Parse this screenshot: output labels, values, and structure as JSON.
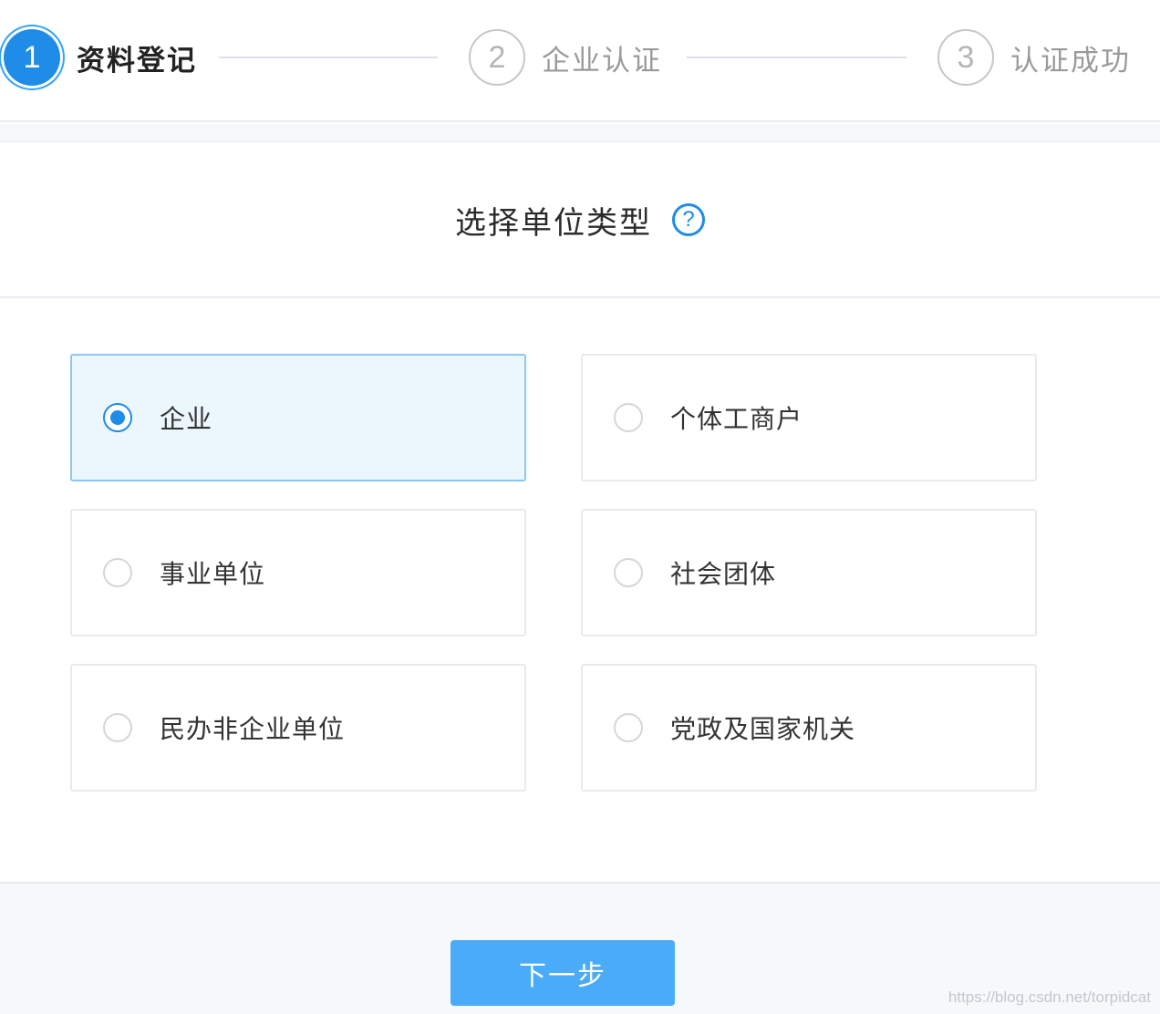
{
  "steps": [
    {
      "number": "1",
      "label": "资料登记",
      "state": "active"
    },
    {
      "number": "2",
      "label": "企业认证",
      "state": "pending"
    },
    {
      "number": "3",
      "label": "认证成功",
      "state": "pending"
    }
  ],
  "section": {
    "title": "选择单位类型",
    "help_icon": "?"
  },
  "options": [
    {
      "label": "企业",
      "selected": true
    },
    {
      "label": "个体工商户",
      "selected": false
    },
    {
      "label": "事业单位",
      "selected": false
    },
    {
      "label": "社会团体",
      "selected": false
    },
    {
      "label": "民办非企业单位",
      "selected": false
    },
    {
      "label": "党政及国家机关",
      "selected": false
    }
  ],
  "actions": {
    "next_label": "下一步"
  },
  "watermark": "https://blog.csdn.net/torpidcat",
  "colors": {
    "accent": "#1f8ce8",
    "button": "#4aabf8",
    "selected_bg": "#ebf6fd",
    "muted": "#9a9a9a"
  }
}
